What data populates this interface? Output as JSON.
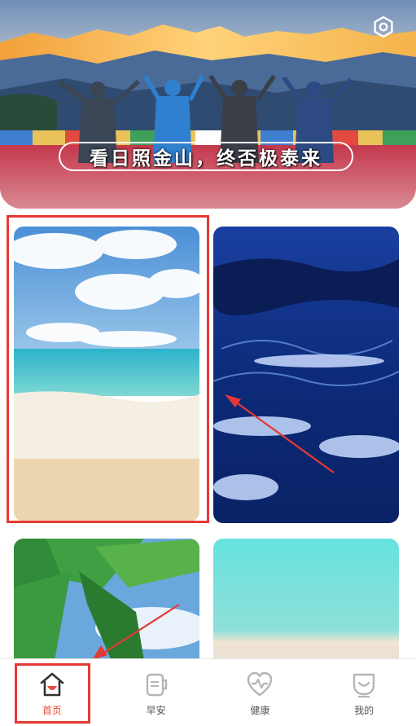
{
  "banner": {
    "slogan": "看日照金山，终否极泰来",
    "settings_icon": "gear-icon"
  },
  "wallpapers": [
    {
      "name": "beach",
      "selected": true
    },
    {
      "name": "ocean-waves",
      "selected": false
    },
    {
      "name": "palm-tree",
      "selected": false
    },
    {
      "name": "mint-gradient",
      "selected": false
    }
  ],
  "tabs": [
    {
      "label": "首页",
      "icon": "home-icon",
      "active": true
    },
    {
      "label": "早安",
      "icon": "cup-icon",
      "active": false
    },
    {
      "label": "健康",
      "icon": "heart-pulse-icon",
      "active": false
    },
    {
      "label": "我的",
      "icon": "profile-icon",
      "active": false
    }
  ],
  "colors": {
    "accent": "#e8493a",
    "highlight_box": "#e53935"
  }
}
